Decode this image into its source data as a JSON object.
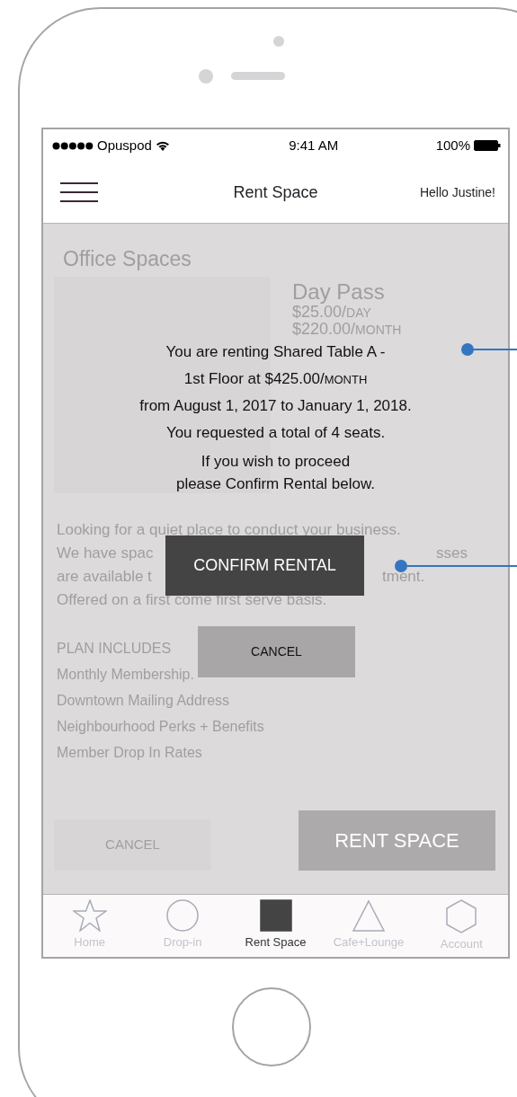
{
  "status_bar": {
    "carrier": "Opuspod",
    "time": "9:41 AM",
    "battery": "100%"
  },
  "nav_bar": {
    "title": "Rent Space",
    "greeting": "Hello Justine!"
  },
  "background": {
    "heading": "Office Spaces",
    "plan": {
      "name": "Day Pass",
      "prices": [
        {
          "amount": "$25.00/",
          "unit": "DAY"
        },
        {
          "amount": "$220.00/",
          "unit": "MONTH"
        }
      ]
    },
    "description": [
      [
        "Looking for a quiet place to conduct your business."
      ],
      [
        "We have spac",
        "sses"
      ],
      [
        "are available t",
        "tment."
      ],
      [
        "Offered on a first come first serve basis."
      ]
    ],
    "includes_heading": "PLAN INCLUDES",
    "includes": [
      "Monthly Membership.",
      "Downtown Mailing Address",
      "Neighbourhood Perks + Benefits",
      "Member Drop In Rates"
    ],
    "buttons": [
      {
        "label": "CANCEL",
        "kind": "secondary"
      },
      {
        "label": "RENT SPACE",
        "kind": "primary"
      }
    ]
  },
  "dialog": {
    "message": [
      {
        "text": "You are renting Shared Table A -"
      },
      {
        "text": "1st Floor at $425.00/",
        "unit": "MONTH"
      },
      {
        "text": "from August 1, 2017 to January 1, 2018."
      },
      {
        "text": "You requested a total of 4 seats."
      }
    ],
    "note": [
      "If you wish to proceed",
      "please Confirm Rental below."
    ],
    "buttons": [
      {
        "label": "CONFIRM RENTAL",
        "kind": "primary"
      },
      {
        "label": "CANCEL",
        "kind": "secondary"
      }
    ]
  },
  "tab_bar": [
    {
      "label": "Home",
      "selected": false
    },
    {
      "label": "Drop-in",
      "selected": false
    },
    {
      "label": "Rent Space",
      "selected": true
    },
    {
      "label": "Cafe+Lounge",
      "selected": false
    },
    {
      "label": "Account",
      "selected": false
    }
  ]
}
